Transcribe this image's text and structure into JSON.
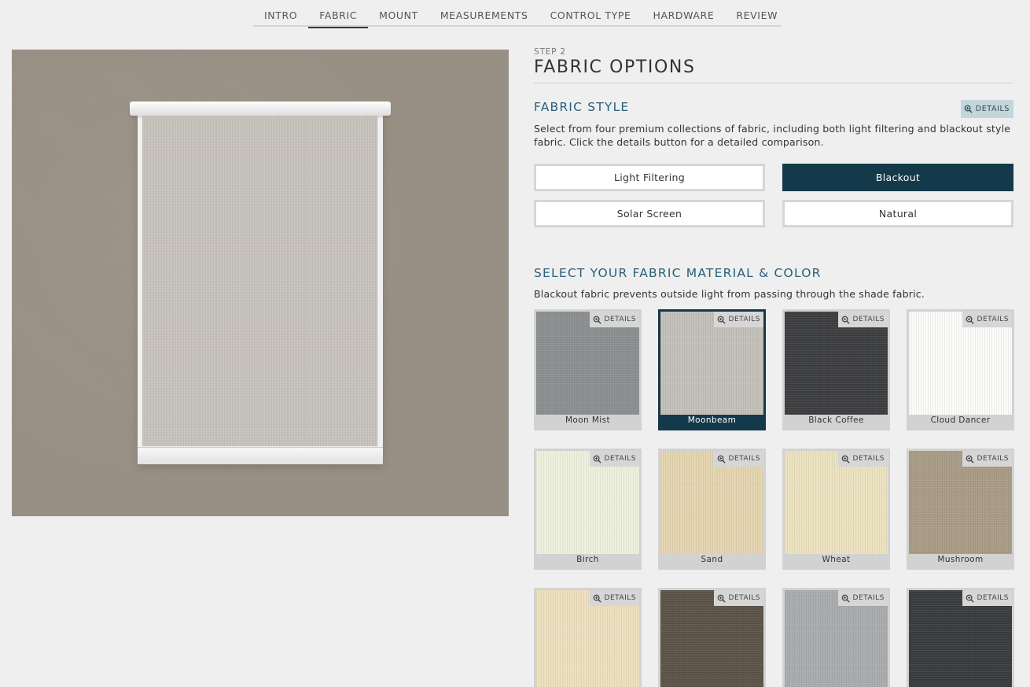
{
  "nav": {
    "items": [
      "INTRO",
      "FABRIC",
      "MOUNT",
      "MEASUREMENTS",
      "CONTROL TYPE",
      "HARDWARE",
      "REVIEW"
    ],
    "active": "FABRIC"
  },
  "step": {
    "label": "STEP 2",
    "title": "FABRIC OPTIONS"
  },
  "fabric_style": {
    "title": "FABRIC STYLE",
    "details_label": "DETAILS",
    "description": "Select from four premium collections of fabric, including both light filtering and blackout style fabric. Click the details button for a detailed comparison.",
    "options": [
      "Light Filtering",
      "Blackout",
      "Solar Screen",
      "Natural"
    ],
    "selected": "Blackout"
  },
  "material": {
    "title": "SELECT YOUR FABRIC MATERIAL & COLOR",
    "description": "Blackout fabric prevents outside light from passing through the shade fabric.",
    "details_label": "DETAILS",
    "swatches": [
      {
        "name": "Moon Mist",
        "color": "#8c8f90"
      },
      {
        "name": "Moonbeam",
        "color": "#c3c0b9"
      },
      {
        "name": "Black Coffee",
        "color": "#3d3e40"
      },
      {
        "name": "Cloud Dancer",
        "color": "#fbfbfa"
      },
      {
        "name": "Birch",
        "color": "#eef0de"
      },
      {
        "name": "Sand",
        "color": "#e4d5b0"
      },
      {
        "name": "Wheat",
        "color": "#ece2bf"
      },
      {
        "name": "Mushroom",
        "color": "#a99c86"
      },
      {
        "name": "",
        "color": "#ede0be"
      },
      {
        "name": "",
        "color": "#5c5348"
      },
      {
        "name": "",
        "color": "#a9abad"
      },
      {
        "name": "",
        "color": "#3a3b3d"
      }
    ],
    "selected": "Moonbeam"
  },
  "colors": {
    "accent": "#13394a",
    "heading": "#2a5f7b",
    "wall": "#9a9186",
    "shade": "#c7c3bc"
  }
}
